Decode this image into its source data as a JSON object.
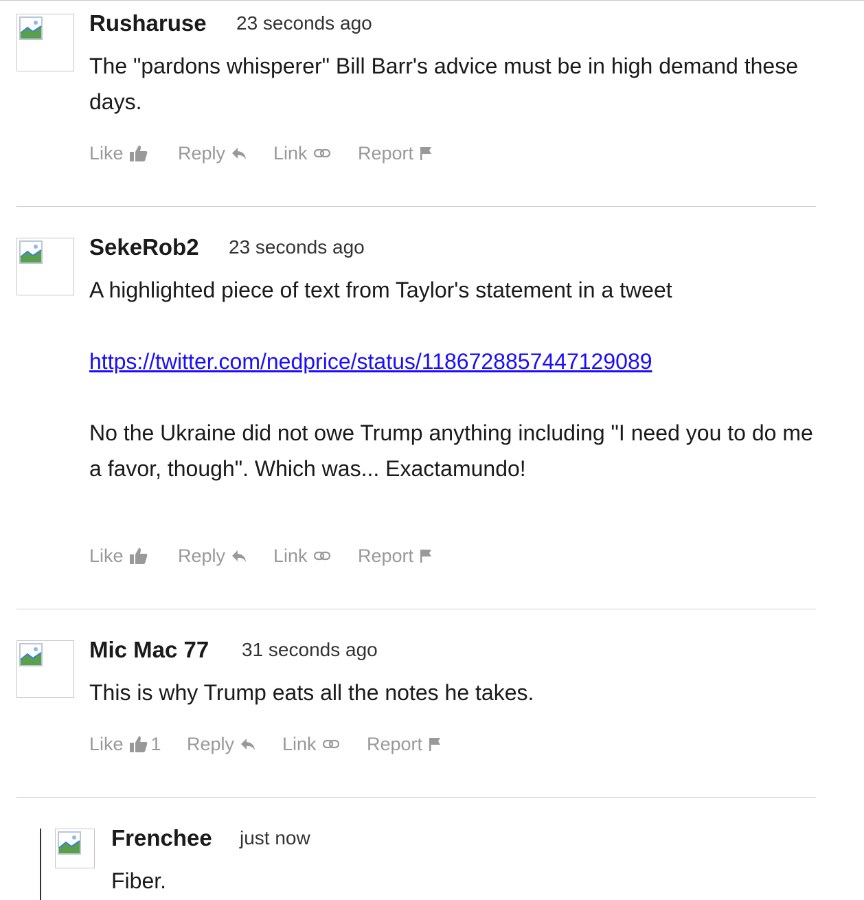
{
  "actions": {
    "like": "Like",
    "reply": "Reply",
    "link": "Link",
    "report": "Report"
  },
  "comments": [
    {
      "author": "Rusharuse",
      "time": "23 seconds ago",
      "paragraphs": [
        "The \"pardons whisperer\" Bill Barr's advice must be in high demand these days."
      ],
      "likes": ""
    },
    {
      "author": "SekeRob2",
      "time": "23 seconds ago",
      "paragraphs": [
        "A highlighted piece of text from Taylor's statement in a tweet",
        "No the Ukraine did not owe Trump anything including \"I need you to do me a favor, though\". Which was... Exactamundo!"
      ],
      "link": "https://twitter.com/nedprice/status/1186728857447129089",
      "likes": ""
    },
    {
      "author": "Mic Mac 77",
      "time": "31 seconds ago",
      "paragraphs": [
        "This is why Trump eats all the notes he takes."
      ],
      "likes": "1"
    },
    {
      "author": "Frenchee",
      "time": "just now",
      "paragraphs": [
        "Fiber."
      ]
    }
  ],
  "colors": {
    "link": "#1a0dff",
    "action_gray": "#999999",
    "divider": "#cfcfcf"
  }
}
